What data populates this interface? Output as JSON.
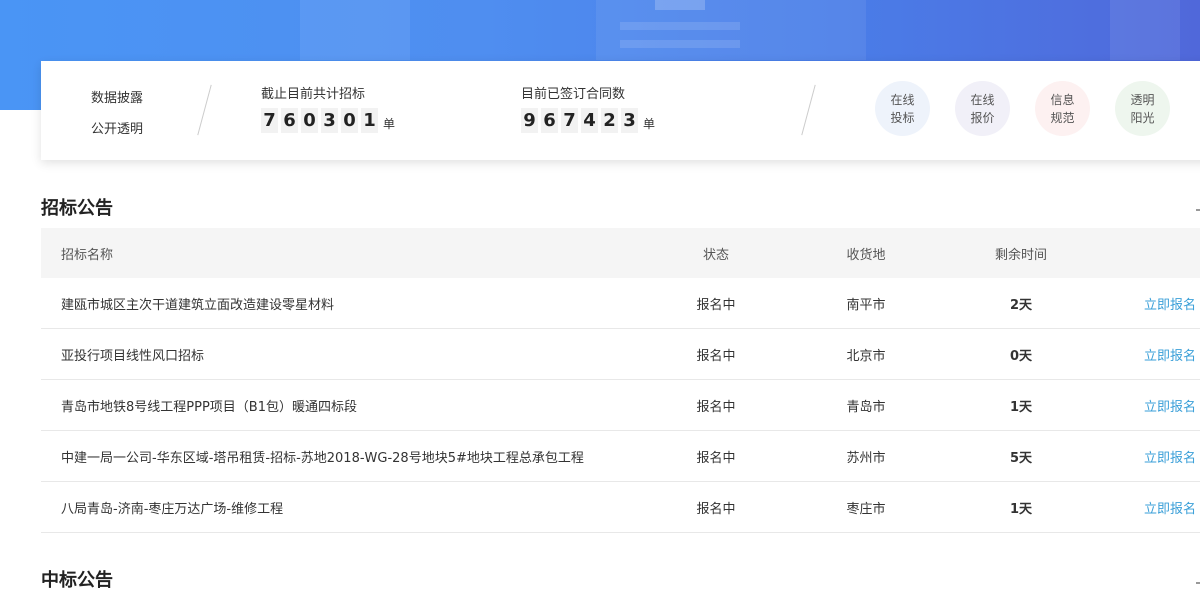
{
  "stats": {
    "disclose_line1": "数据披露",
    "disclose_line2": "公开透明",
    "tender_label": "截止目前共计招标",
    "tender_digits": [
      "7",
      "6",
      "0",
      "3",
      "0",
      "1"
    ],
    "tender_unit": "单",
    "contract_label": "目前已签订合同数",
    "contract_digits": [
      "9",
      "6",
      "7",
      "4",
      "2",
      "3"
    ],
    "contract_unit": "单"
  },
  "quick_links": [
    {
      "line1": "在线",
      "line2": "投标",
      "bg": "#eef3fb"
    },
    {
      "line1": "在线",
      "line2": "报价",
      "bg": "#f1f0f8"
    },
    {
      "line1": "信息",
      "line2": "规范",
      "bg": "#fdf1f1"
    },
    {
      "line1": "透明",
      "line2": "阳光",
      "bg": "#eef6ee"
    }
  ],
  "tender_section": {
    "title": "招标公告",
    "headers": {
      "name": "招标名称",
      "status": "状态",
      "place": "收货地",
      "remaining": "剩余时间"
    },
    "rows": [
      {
        "name": "建瓯市城区主次干道建筑立面改造建设零星材料",
        "status": "报名中",
        "place": "南平市",
        "days": "2天",
        "action": "立即报名"
      },
      {
        "name": "亚投行项目线性风口招标",
        "status": "报名中",
        "place": "北京市",
        "days": "0天",
        "action": "立即报名"
      },
      {
        "name": "青岛市地铁8号线工程PPP项目（B1包）暖通四标段",
        "status": "报名中",
        "place": "青岛市",
        "days": "1天",
        "action": "立即报名"
      },
      {
        "name": "中建一局一公司-华东区域-塔吊租赁-招标-苏地2018-WG-28号地块5#地块工程总承包工程",
        "status": "报名中",
        "place": "苏州市",
        "days": "5天",
        "action": "立即报名"
      },
      {
        "name": "八局青岛-济南-枣庄万达广场-维修工程",
        "status": "报名中",
        "place": "枣庄市",
        "days": "1天",
        "action": "立即报名"
      }
    ]
  },
  "award_section": {
    "title": "中标公告"
  },
  "colors": {
    "link": "#3a9fd8",
    "banner_start": "#4a95f5",
    "banner_end": "#5068da"
  }
}
